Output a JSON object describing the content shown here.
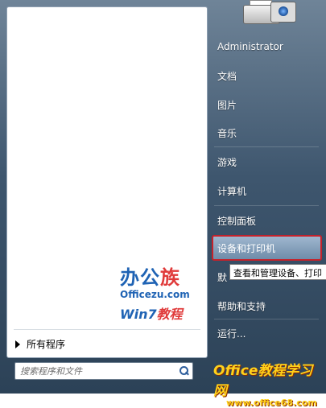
{
  "right_items": [
    {
      "label": "Administrator",
      "name": "menu-administrator"
    },
    {
      "label": "文档",
      "name": "menu-documents"
    },
    {
      "label": "图片",
      "name": "menu-pictures"
    },
    {
      "label": "音乐",
      "name": "menu-music"
    },
    {
      "label": "游戏",
      "name": "menu-games"
    },
    {
      "label": "计算机",
      "name": "menu-computer"
    },
    {
      "label": "控制面板",
      "name": "menu-control-panel"
    },
    {
      "label": "设备和打印机",
      "name": "menu-devices-printers"
    },
    {
      "label": "默",
      "name": "menu-default-programs"
    },
    {
      "label": "帮助和支持",
      "name": "menu-help-support"
    },
    {
      "label": "运行...",
      "name": "menu-run"
    }
  ],
  "tooltip": "查看和管理设备、打印",
  "all_programs": "所有程序",
  "search": {
    "placeholder": "搜索程序和文件"
  },
  "logo": {
    "line1a": "办公",
    "line1b": "族",
    "line2": "Officezu.com",
    "line3a": "Win7",
    "line3b": "教程"
  },
  "watermark": {
    "line1": "Office教程学习网",
    "line2": "www.office68.com"
  }
}
